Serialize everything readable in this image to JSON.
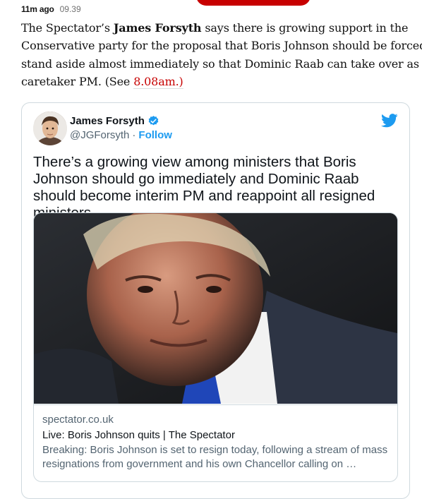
{
  "entry": {
    "time_ago": "11m ago",
    "time": "09.39",
    "text_before": "The Spectator’s ",
    "author_bold": "James Forsyth",
    "text_after": " says there is growing support in the Conservative party for the proposal that Boris Johnson should be forced to stand aside almost immediately so that Dominic Raab can take over as a caretaker PM. (See ",
    "link_text": "8.08am.)"
  },
  "tweet": {
    "author_name": "James Forsyth",
    "handle": "@JGForsyth",
    "separator": "·",
    "follow_label": "Follow",
    "text": "There’s a growing view among ministers that Boris Johnson should go immediately and Dominic Raab should become interim PM and reappoint all resigned ministers",
    "card": {
      "domain": "spectator.co.uk",
      "title": "Live: Boris Johnson quits | The Spectator",
      "description": "Breaking: Boris Johnson is set to resign today, following a stream of mass resignations from government and his own Chancellor calling on …"
    }
  },
  "colors": {
    "accent_red": "#c70000",
    "twitter_blue": "#1d9bf0"
  },
  "icons": [
    "verified-badge-icon",
    "twitter-bird-icon"
  ]
}
